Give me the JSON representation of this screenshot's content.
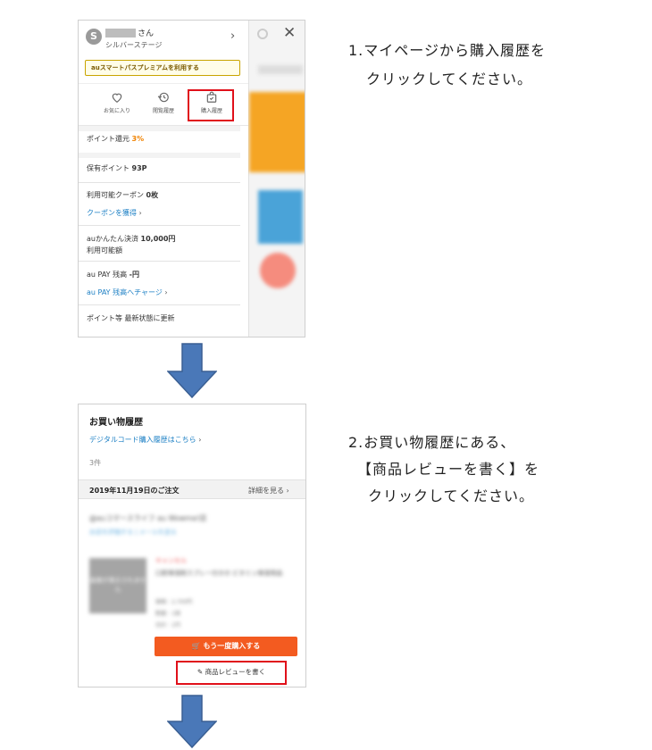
{
  "step1": {
    "instruction_line1": "1.マイページから購入履歴を",
    "instruction_line2": "クリックしてください。",
    "menu": {
      "avatar_letter": "S",
      "name_suffix": "さん",
      "stage": "シルバーステージ",
      "premium_button": "auスマートパスプレミアムを利用する",
      "icons": [
        {
          "label": "お気に入り",
          "icon": "heart-icon"
        },
        {
          "label": "閲覧履歴",
          "icon": "history-icon"
        },
        {
          "label": "購入履歴",
          "icon": "shopping-bag-icon"
        }
      ],
      "points_return_label": "ポイント還元",
      "points_return_value": "3%",
      "held_points_label": "保有ポイント",
      "held_points_value": "93P",
      "coupon_label": "利用可能クーポン",
      "coupon_value": "0枚",
      "coupon_link": "クーポンを獲得",
      "au_easy_label": "auかんたん決済",
      "au_easy_value": "10,000円",
      "au_easy_sub": "利用可能額",
      "au_pay_label": "au PAY 残高",
      "au_pay_value": "-円",
      "au_pay_link": "au PAY 残高へチャージ",
      "update_label": "ポイント等 最新状態に更新"
    }
  },
  "step2": {
    "instruction_line1": "2.お買い物履歴にある、",
    "instruction_line2": "【商品レビューを書く】を",
    "instruction_line3": "クリックしてください。",
    "history": {
      "title": "お買い物履歴",
      "digital_link": "デジタルコード購入履歴はこちら",
      "count": "3件",
      "order_date": "2019年11月19日のご注文",
      "detail_link": "詳細を見る",
      "shop_name": "@auコマースライフ au Wowma!店",
      "shop_links": "お店を評価する | メールを送る",
      "thumb_text": "画像が表示されません",
      "item_status": "キャンセル",
      "item_name": "口腔保湿剤スプレー付きの ビタミン保湿用品",
      "item_specs": [
        "価格：2,700円",
        "数量：1個",
        "合計：1円"
      ],
      "rebuy_button": "もう一度購入する",
      "review_button": "商品レビューを書く"
    }
  },
  "colors": {
    "highlight": "#e0101a",
    "link": "#1b7fc4",
    "orange_button": "#f35b20",
    "arrow": "#4a78b8"
  }
}
